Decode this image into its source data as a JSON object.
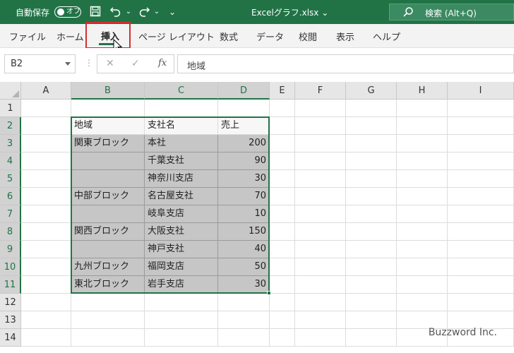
{
  "title_bar": {
    "autosave_label": "自動保存",
    "autosave_state": "オフ",
    "filename": "Excelグラフ.xlsx ⌄",
    "search_placeholder": "検索 (Alt+Q)",
    "accent_color": "#217346"
  },
  "ribbon": {
    "tabs": [
      "ファイル",
      "ホーム",
      "挿入",
      "ページ レイアウト",
      "数式",
      "データ",
      "校閲",
      "表示",
      "ヘルプ"
    ],
    "active_tab": "挿入"
  },
  "formula_bar": {
    "name_box": "B2",
    "formula": "地域"
  },
  "sheet": {
    "columns": [
      "A",
      "B",
      "C",
      "D",
      "E",
      "F",
      "G",
      "H",
      "I"
    ],
    "rows": [
      "1",
      "2",
      "3",
      "4",
      "5",
      "6",
      "7",
      "8",
      "9",
      "10",
      "11",
      "12",
      "13",
      "14"
    ],
    "selected_range": "B2:D11",
    "table": {
      "headers": [
        "地域",
        "支社名",
        "売上"
      ],
      "rows": [
        [
          "関東ブロック",
          "本社",
          "200"
        ],
        [
          "",
          "千葉支社",
          "90"
        ],
        [
          "",
          "神奈川支店",
          "30"
        ],
        [
          "中部ブロック",
          "名古屋支社",
          "70"
        ],
        [
          "",
          "岐阜支店",
          "10"
        ],
        [
          "関西ブロック",
          "大阪支社",
          "150"
        ],
        [
          "",
          "神戸支社",
          "40"
        ],
        [
          "九州ブロック",
          "福岡支店",
          "50"
        ],
        [
          "東北ブロック",
          "岩手支店",
          "30"
        ]
      ]
    }
  },
  "watermark": "Buzzword Inc."
}
